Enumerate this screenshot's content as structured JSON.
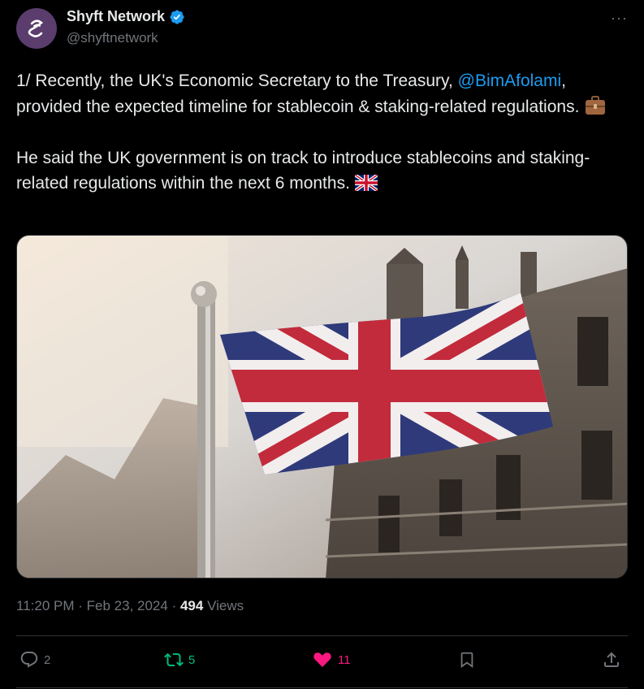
{
  "author": {
    "display_name": "Shyft Network",
    "handle": "@shyftnetwork",
    "verified": true,
    "avatar_icon": "shyft-logo-icon"
  },
  "tweet": {
    "para1_before": "1/ Recently, the UK's Economic Secretary to the Treasury, ",
    "mention": "@BimAfolami",
    "para1_after": ", provided the expected timeline for stablecoin & staking-related regulations. ",
    "para1_emoji": "briefcase-icon",
    "para2": "He said the UK government is on track to introduce stablecoins and staking-related regulations within the next 6 months. ",
    "para2_emoji": "uk-flag-icon"
  },
  "media": {
    "description_icon": "union-jack-photo"
  },
  "meta": {
    "time": "11:20 PM",
    "date": "Feb 23, 2024",
    "views_count": "494",
    "views_label": "Views"
  },
  "actions": {
    "replies": "2",
    "reposts": "5",
    "likes": "11"
  },
  "colors": {
    "accent": "#1d9bf0",
    "like": "#f91880",
    "repost": "#00ba7c",
    "muted": "#71767b"
  }
}
